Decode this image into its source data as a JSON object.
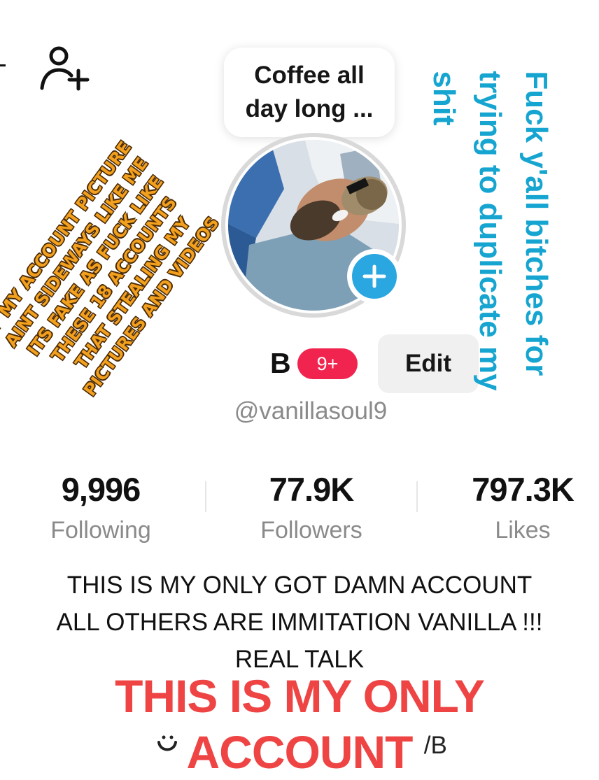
{
  "overlay_caption": "Coffee all day long ...",
  "profile": {
    "name_initial": "B",
    "notification_badge": "9+",
    "edit_label": "Edit",
    "username": "@vanillasoul9"
  },
  "stats": [
    {
      "value": "9,996",
      "label": "Following"
    },
    {
      "value": "77.9K",
      "label": "Followers"
    },
    {
      "value": "797.3K",
      "label": "Likes"
    }
  ],
  "bio": {
    "lines": [
      "THIS IS MY ONLY GOT DAMN ACCOUNT",
      "ALL OTHERS ARE IMMITATION VANILLA !!!",
      "REAL TALK"
    ]
  },
  "link": {
    "text": "/B"
  },
  "overlays": {
    "red_lines": [
      "THIS IS MY ONLY",
      "ACCOUNT"
    ],
    "orange_lines": [
      "IF MY ACCOUNT PICTURE",
      "AINT SIDEWAYS LIKE ME",
      "ITS FAKE AS FUCK LIKE",
      "THESE 18 ACCOUNTS",
      "THAT STEALING MY",
      "PICTURES AND VIDEOS"
    ],
    "cyan_lines": [
      "Fuck y'all bitches for",
      "trying to duplicate my",
      "shit"
    ]
  },
  "icons": {
    "add_friend": "add-friend-icon",
    "add_avatar": "plus-icon",
    "smile": "smile-icon"
  },
  "colors": {
    "badge": "#f0244e",
    "plus_button": "#2aa6e0",
    "red_overlay": "#ee4444",
    "orange_overlay": "#f2a01e",
    "cyan_overlay": "#16a5d0"
  }
}
